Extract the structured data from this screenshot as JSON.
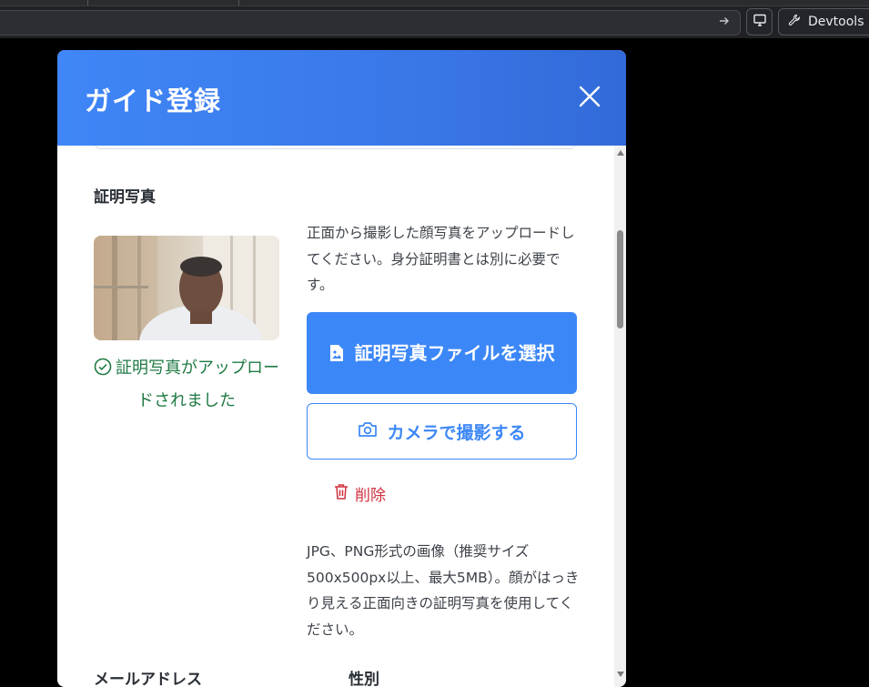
{
  "browser": {
    "devtools_label": "Devtools",
    "url_go_icon": "arrow-right-icon",
    "screen_icon": "monitor-icon",
    "devtools_icon": "wrench-icon"
  },
  "modal": {
    "title": "ガイド登録",
    "close_icon": "close-icon",
    "header_color": "#3c87f7"
  },
  "photo_section": {
    "label": "証明写真",
    "status": "証明写真がアップロードされました",
    "status_color": "#1f7a44",
    "help_text": "正面から撮影した顔写真をアップロードしてください。身分証明書とは別に必要です。",
    "select_button": "証明写真ファイルを選択",
    "camera_button": "カメラで撮影する",
    "delete_button": "削除",
    "delete_color": "#d0313e",
    "format_text": "JPG、PNG形式の画像（推奨サイズ500x500px以上、最大5MB）。顔がはっきり見える正面向きの証明写真を使用してください。"
  },
  "next_fields": {
    "email_label": "メールアドレス",
    "gender_label": "性別"
  }
}
